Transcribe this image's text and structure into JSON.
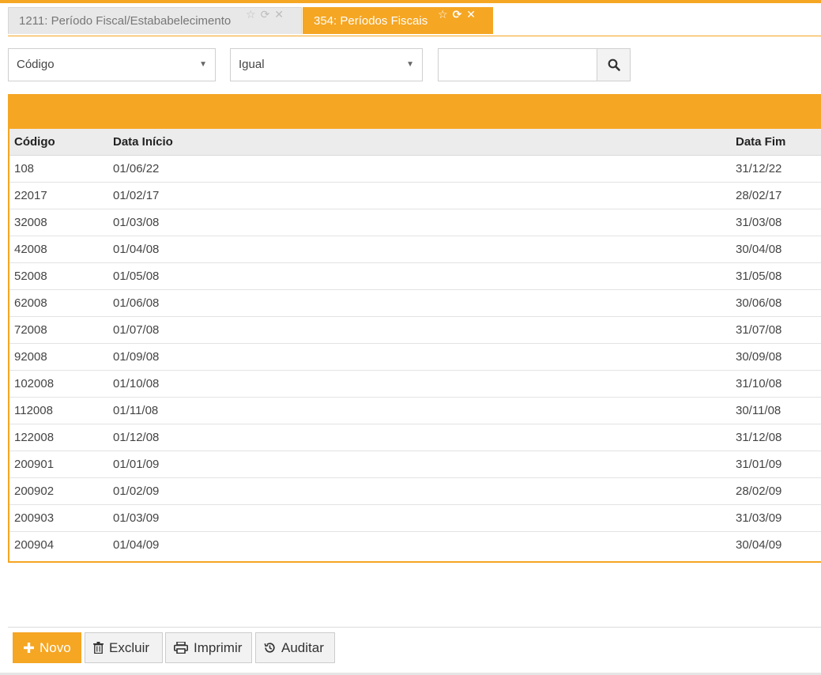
{
  "tabs": [
    {
      "label": "1211: Período Fiscal/Estababelecimento",
      "active": false
    },
    {
      "label": "354: Períodos Fiscais",
      "active": true
    }
  ],
  "filters": {
    "field": "Código",
    "operator": "Igual",
    "value": ""
  },
  "table": {
    "columns": [
      "Código",
      "Data Início",
      "Data Fim"
    ],
    "rows": [
      [
        "108",
        "01/06/22",
        "31/12/22"
      ],
      [
        "22017",
        "01/02/17",
        "28/02/17"
      ],
      [
        "32008",
        "01/03/08",
        "31/03/08"
      ],
      [
        "42008",
        "01/04/08",
        "30/04/08"
      ],
      [
        "52008",
        "01/05/08",
        "31/05/08"
      ],
      [
        "62008",
        "01/06/08",
        "30/06/08"
      ],
      [
        "72008",
        "01/07/08",
        "31/07/08"
      ],
      [
        "92008",
        "01/09/08",
        "30/09/08"
      ],
      [
        "102008",
        "01/10/08",
        "31/10/08"
      ],
      [
        "112008",
        "01/11/08",
        "30/11/08"
      ],
      [
        "122008",
        "01/12/08",
        "31/12/08"
      ],
      [
        "200901",
        "01/01/09",
        "31/01/09"
      ],
      [
        "200902",
        "01/02/09",
        "28/02/09"
      ],
      [
        "200903",
        "01/03/09",
        "31/03/09"
      ],
      [
        "200904",
        "01/04/09",
        "30/04/09"
      ]
    ]
  },
  "actions": {
    "novo": "Novo",
    "excluir": "Excluir",
    "imprimir": "Imprimir",
    "auditar": "Auditar"
  },
  "colors": {
    "accent": "#f5a623",
    "header_bg": "#ececec"
  }
}
